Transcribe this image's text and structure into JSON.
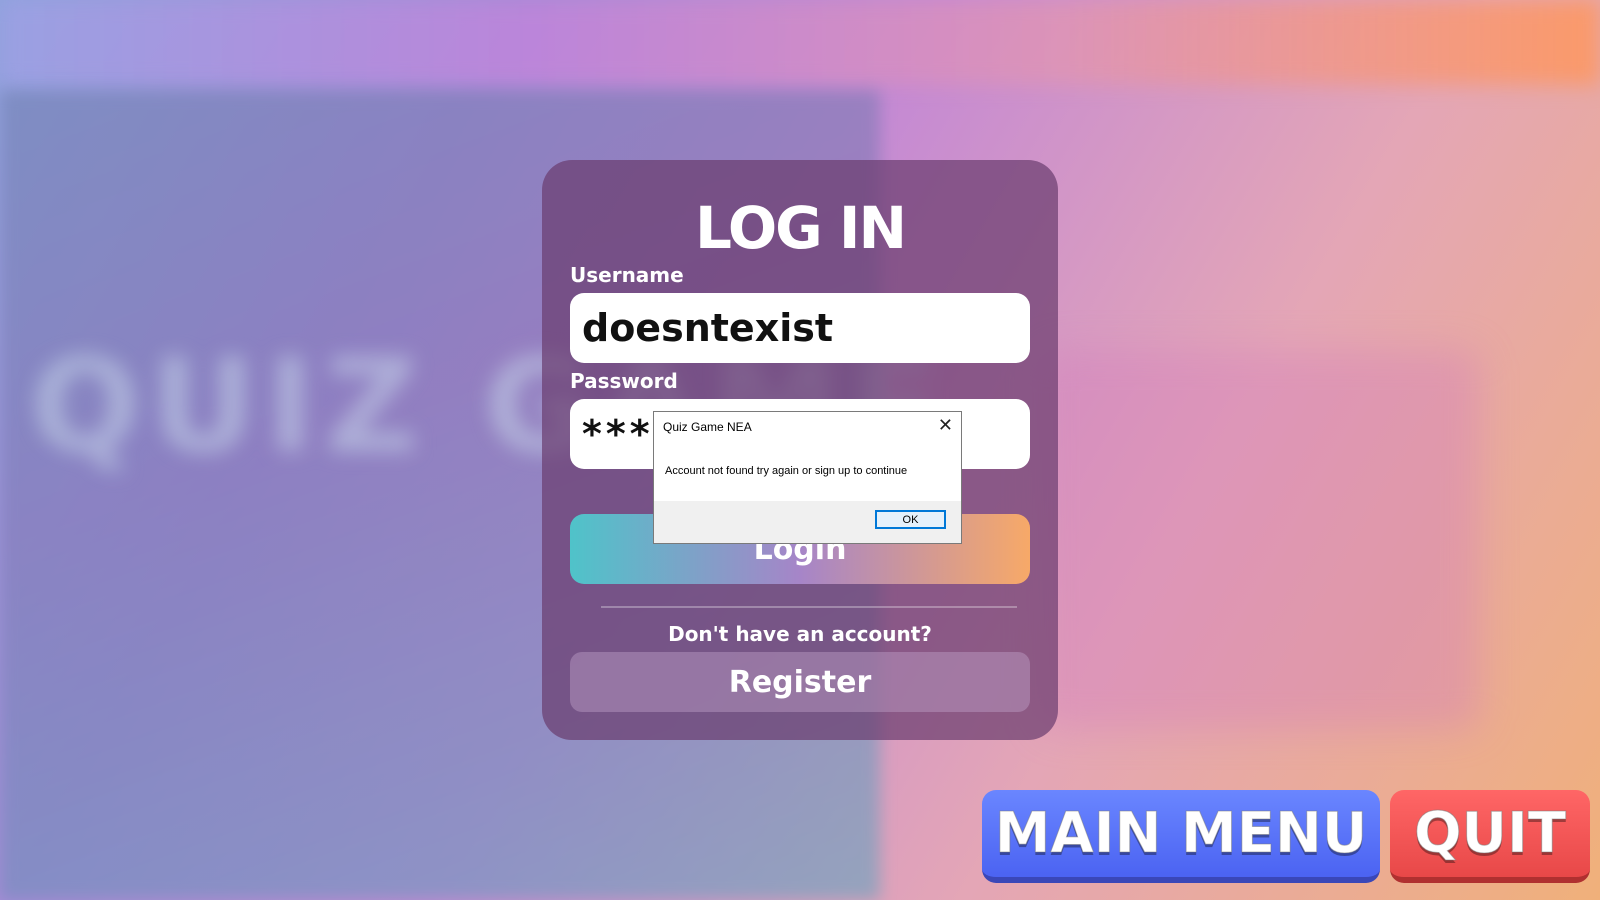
{
  "login_card": {
    "title": "LOG IN",
    "username_label": "Username",
    "username_value": "doesntexist",
    "password_label": "Password",
    "password_value": "*****",
    "login_button": "Login",
    "no_account_text": "Don't have an account?",
    "register_button": "Register"
  },
  "dialog": {
    "title": "Quiz Game NEA",
    "message": "Account not found try again or sign up to continue",
    "ok_button": "OK",
    "close_icon": "close-icon"
  },
  "bottom_buttons": {
    "main_menu": "MAIN MENU",
    "quit": "QUIT"
  },
  "colors": {
    "main_menu_button": "#4b63f2",
    "quit_button": "#e84848",
    "card_background": "#693c6e"
  }
}
